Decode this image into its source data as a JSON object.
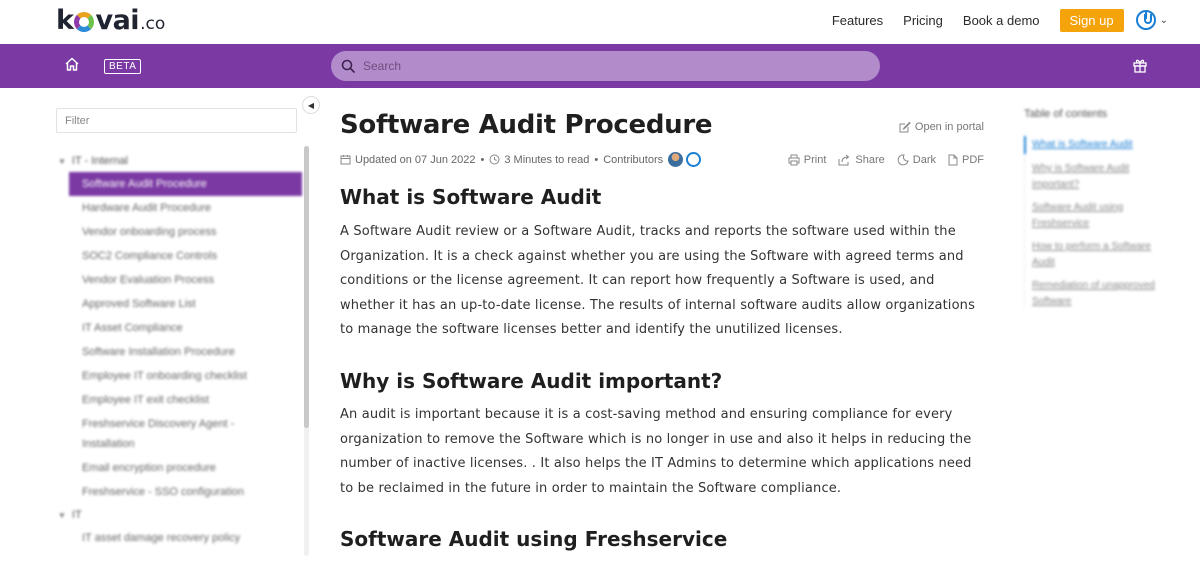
{
  "brand": {
    "logo_left": "k",
    "logo_mid": "va",
    "logo_i": "i",
    "logo_suffix": ".co"
  },
  "nav": {
    "features": "Features",
    "pricing": "Pricing",
    "book_demo": "Book a demo",
    "signup": "Sign up"
  },
  "topbar": {
    "beta": "BETA",
    "search_placeholder": "Search"
  },
  "sidebar": {
    "filter_placeholder": "Filter",
    "groups": [
      {
        "label": "IT - Internal",
        "items": [
          "Software Audit Procedure",
          "Hardware Audit Procedure",
          "Vendor onboarding process",
          "SOC2 Compliance Controls",
          "Vendor Evaluation Process",
          "Approved Software List",
          "IT Asset Compliance",
          "Software Installation Procedure",
          "Employee IT onboarding checklist",
          "Employee IT exit checklist",
          "Freshservice Discovery Agent - Installation",
          "Email encryption procedure",
          "Freshservice - SSO configuration"
        ]
      },
      {
        "label": "IT",
        "items": [
          "IT asset damage recovery policy"
        ]
      }
    ]
  },
  "article": {
    "title": "Software Audit Procedure",
    "open_in_portal": "Open in portal",
    "updated": "Updated on 07 Jun 2022",
    "read_time": "3 Minutes to read",
    "contributors": "Contributors",
    "actions": {
      "print": "Print",
      "share": "Share",
      "dark": "Dark",
      "pdf": "PDF"
    },
    "sections": [
      {
        "heading": "What is Software Audit",
        "body": "A Software Audit review or a Software Audit, tracks and reports the software used within the Organization. It is a check against whether you are using the Software with agreed terms and conditions or the license agreement. It can report how frequently a Software is used, and whether it has an up-to-date license.  The results of internal software audits allow organizations to manage the software licenses better and identify the unutilized licenses."
      },
      {
        "heading": "Why is Software Audit important?",
        "body": "An audit is important because it is a cost-saving method and ensuring compliance for every organization to remove the Software which is no longer in use and also it helps in reducing the number of inactive licenses. . It also helps the IT Admins to determine which applications need to be reclaimed in the future in order to maintain the Software compliance."
      },
      {
        "heading": "Software Audit using Freshservice",
        "body": ""
      }
    ]
  },
  "toc": {
    "title": "Table of contents",
    "items": [
      "What is Software Audit",
      "Why is Software Audit important?",
      "Software Audit using Freshservice",
      "How to perform a Software Audit",
      "Remediation of unapproved Software"
    ]
  },
  "colors": {
    "brand_purple": "#7b3aa3",
    "signup_orange": "#f5a30a",
    "link_blue": "#1a7fd4"
  }
}
